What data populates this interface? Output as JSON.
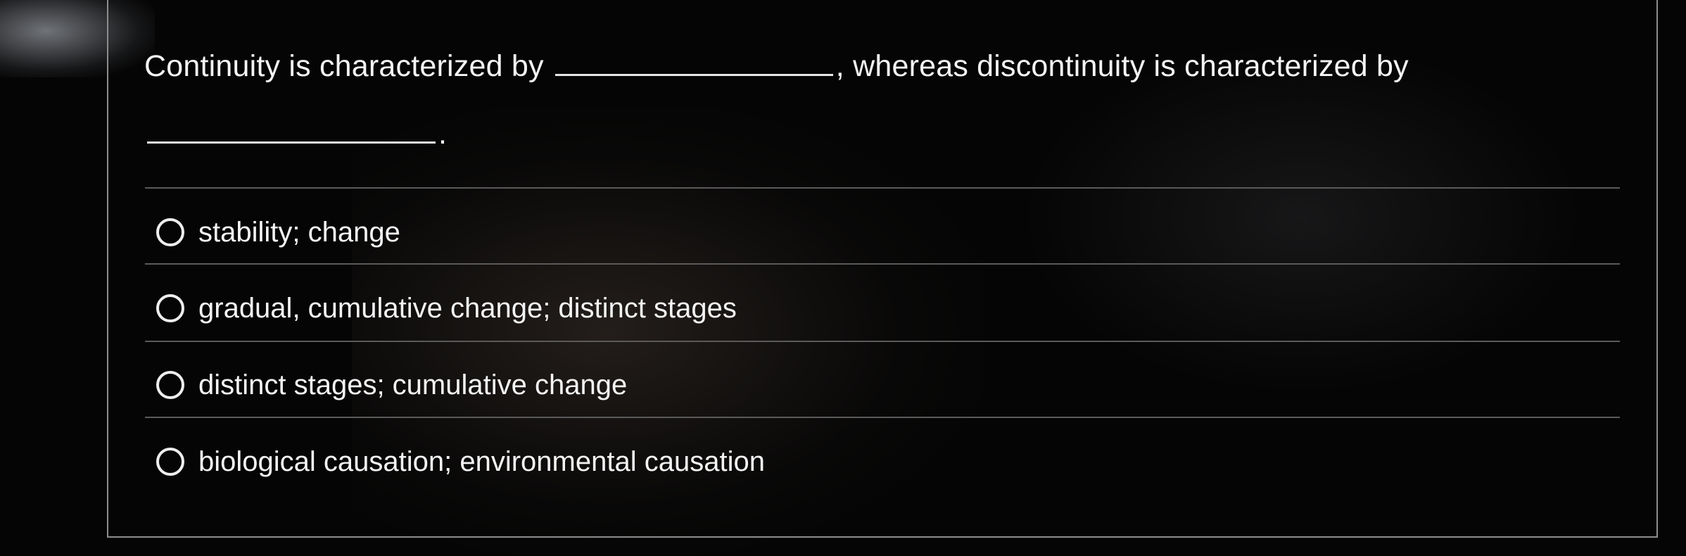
{
  "question": {
    "part1": "Continuity is characterized by ",
    "part2": ", whereas discontinuity is characterized by ",
    "part3": "."
  },
  "answers": [
    {
      "label": "stability; change"
    },
    {
      "label": "gradual, cumulative change; distinct stages"
    },
    {
      "label": "distinct stages; cumulative change"
    },
    {
      "label": "biological causation; environmental causation"
    }
  ]
}
